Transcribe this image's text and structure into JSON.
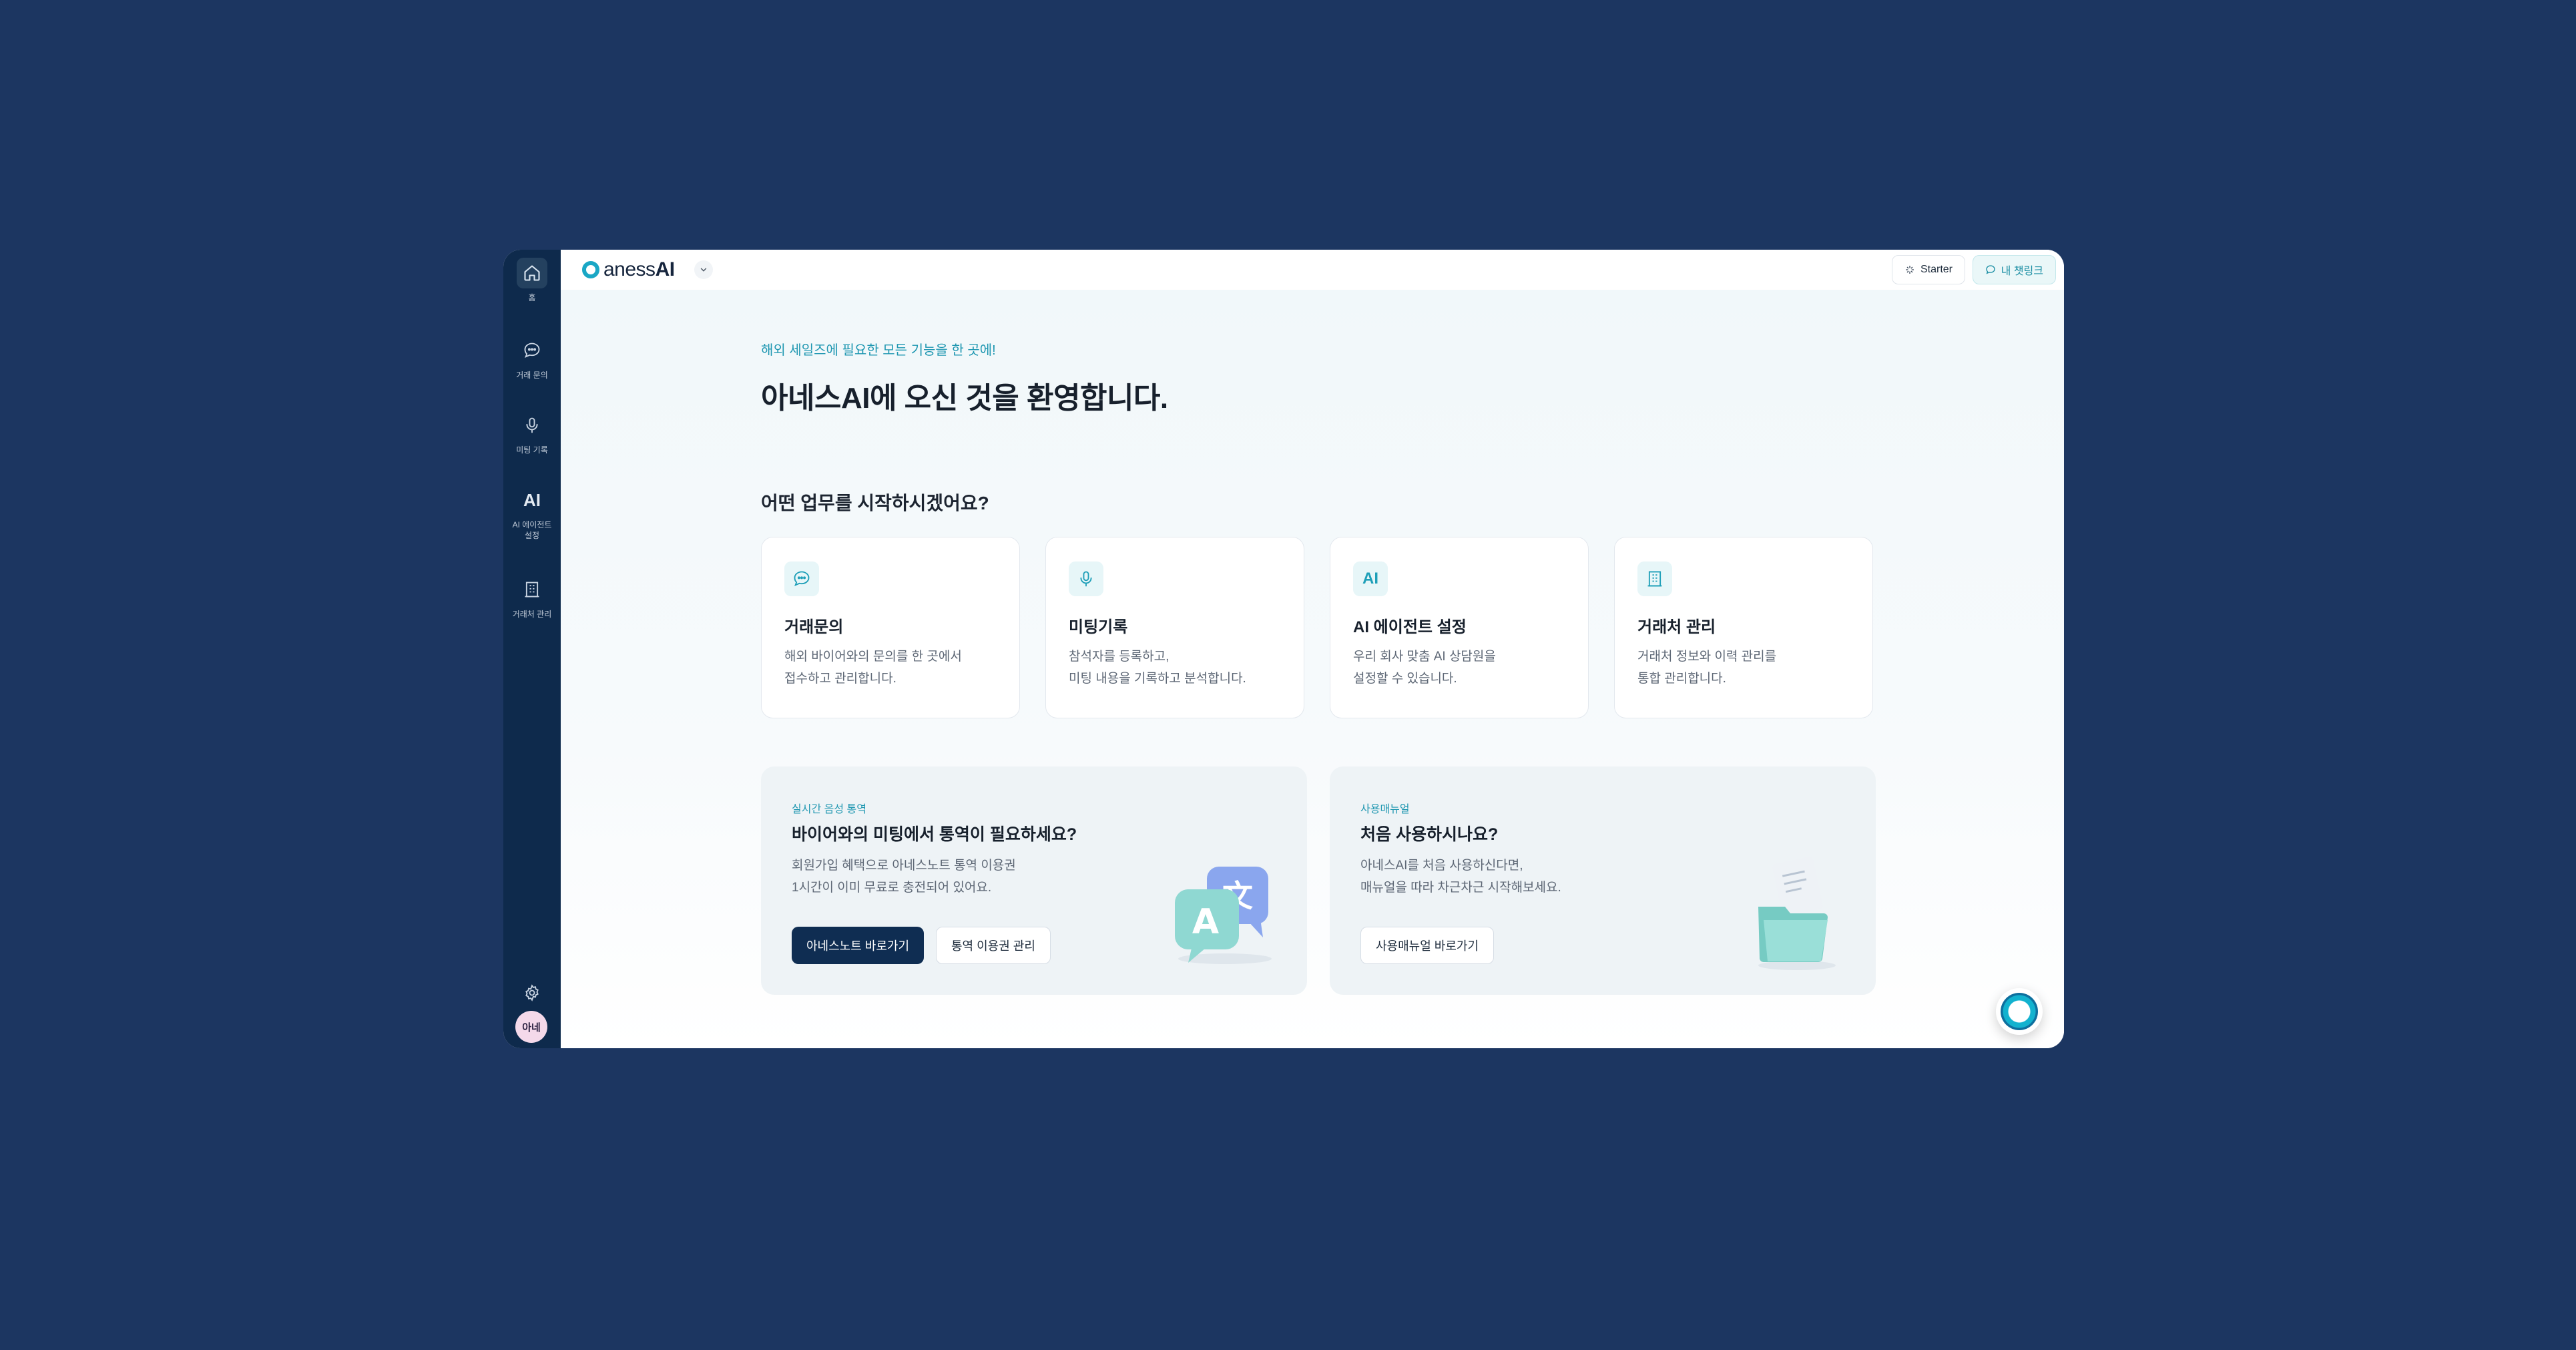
{
  "sidebar": {
    "items": [
      {
        "label": "홈",
        "icon": "home-icon"
      },
      {
        "label": "거래 문의",
        "icon": "chat-icon"
      },
      {
        "label": "미팅 기록",
        "icon": "microphone-icon"
      },
      {
        "label": "AI 에이전트 설정",
        "icon": "ai-icon",
        "icon_text": "AI"
      },
      {
        "label": "거래처 관리",
        "icon": "building-icon"
      }
    ],
    "settings_icon": "gear-icon",
    "avatar_text": "아네"
  },
  "topbar": {
    "logo_prefix": "aness",
    "logo_suffix": "AI",
    "workspace_dropdown_icon": "chevron-down-icon",
    "plan_label": "Starter",
    "link_label": "내 챗링크"
  },
  "main": {
    "eyebrow": "해외 세일즈에 필요한 모든 기능을 한 곳에!",
    "welcome": "아네스AI에 오신 것을 환영합니다.",
    "section_title": "어떤 업무를 시작하시겠어요?",
    "cards": [
      {
        "title": "거래문의",
        "desc_line1": "해외 바이어와의 문의를 한 곳에서",
        "desc_line2": "접수하고 관리합니다.",
        "icon": "chat-icon"
      },
      {
        "title": "미팅기록",
        "desc_line1": "참석자를 등록하고,",
        "desc_line2": "미팅 내용을 기록하고 분석합니다.",
        "icon": "microphone-icon"
      },
      {
        "title": "AI 에이전트 설정",
        "desc_line1": "우리 회사 맞춤 AI 상담원을",
        "desc_line2": "설정할 수 있습니다.",
        "icon": "ai-icon",
        "icon_text": "AI"
      },
      {
        "title": "거래처 관리",
        "desc_line1": "거래처 정보와 이력 관리를",
        "desc_line2": "통합 관리합니다.",
        "icon": "building-icon"
      }
    ],
    "promos": [
      {
        "tag": "실시간 음성 통역",
        "title": "바이어와의 미팅에서 통역이 필요하세요?",
        "desc_line1": "회원가입 혜택으로 아네스노트 통역 이용권",
        "desc_line2": "1시간이 이미 무료로 충전되어 있어요.",
        "primary_button": "아네스노트 바로가기",
        "secondary_button": "통역 이용권 관리",
        "illustration": "translate-illustration"
      },
      {
        "tag": "사용매뉴얼",
        "title": "처음 사용하시나요?",
        "desc_line1": "아네스AI를 처음 사용하신다면,",
        "desc_line2": "매뉴얼을 따라 차근차근 시작해보세요.",
        "secondary_button": "사용매뉴얼 바로가기",
        "illustration": "folder-illustration"
      }
    ]
  },
  "colors": {
    "page_background": "#1c3661",
    "sidebar": "#0e2a4c",
    "accent": "#1f97b1",
    "primary_button": "#0f2d52"
  }
}
